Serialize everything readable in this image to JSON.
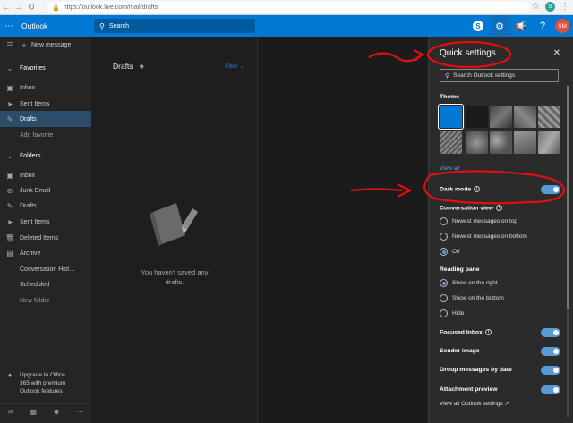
{
  "browser": {
    "url": "https://outlook.live.com/mail/drafts",
    "profile_initial": "S"
  },
  "header": {
    "app_name": "Outlook",
    "search_placeholder": "Search",
    "avatar_initials": "SM",
    "accent_color": "#0078d4"
  },
  "leftnav": {
    "new_message": "New message",
    "favorites": {
      "heading": "Favorites",
      "items": [
        "Inbox",
        "Sent Items",
        "Drafts",
        "Add favorite"
      ]
    },
    "folders": {
      "heading": "Folders",
      "items": [
        "Inbox",
        "Junk Email",
        "Drafts",
        "Sent Items",
        "Deleted Items",
        "Archive",
        "Conversation Hist...",
        "Scheduled",
        "New folder"
      ]
    },
    "upgrade_text": [
      "Upgrade to Office",
      "365 with premium",
      "Outlook features"
    ]
  },
  "message_list": {
    "title": "Drafts",
    "filter_label": "Filter",
    "empty_text": [
      "You haven't saved any",
      "drafts."
    ]
  },
  "quick_settings": {
    "title": "Quick settings",
    "search_placeholder": "Search Outlook settings",
    "theme_label": "Theme",
    "view_all": "View all",
    "dark_mode_label": "Dark mode",
    "dark_mode_on": true,
    "conversation_view_label": "Conversation view",
    "conversation_options": [
      "Newest messages on top",
      "Newest messages on bottom",
      "Off"
    ],
    "conversation_selected": "Off",
    "reading_pane_label": "Reading pane",
    "reading_options": [
      "Show on the right",
      "Show on the bottom",
      "Hide"
    ],
    "reading_selected": "Show on the right",
    "focused_inbox_label": "Focused Inbox",
    "sender_image_label": "Sender image",
    "group_messages_label": "Group messages by date",
    "attachment_preview_label": "Attachment preview",
    "view_all_settings": "View all Outlook settings"
  }
}
